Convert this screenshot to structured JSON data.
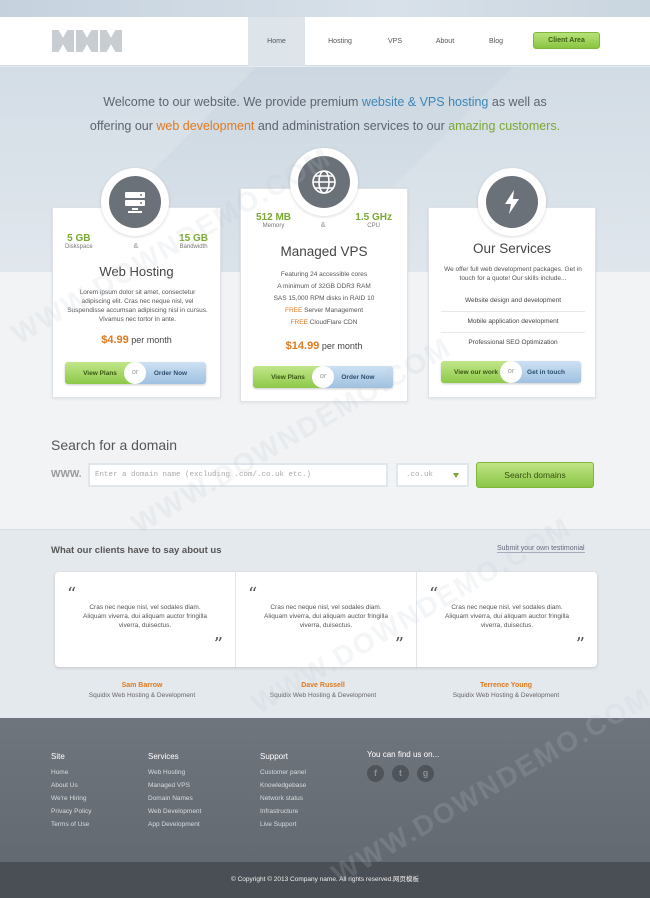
{
  "nav": {
    "items": [
      "Home",
      "Hosting",
      "VPS",
      "About",
      "Blog"
    ],
    "client_area": "Client Area"
  },
  "hero": {
    "line1_a": "Welcome to our website. We provide premium ",
    "line1_b": "website & VPS hosting",
    "line1_c": " as well as",
    "line2_a": "offering our ",
    "line2_b": "web development",
    "line2_c": " and administration services to our ",
    "line2_d": "amazing customers."
  },
  "cards": {
    "web": {
      "spec1_val": "5 GB",
      "spec1_lbl": "Diskspace",
      "amp": "&",
      "spec2_val": "15 GB",
      "spec2_lbl": "Bandwidth",
      "title": "Web Hosting",
      "desc": "Lorem ipsum dolor sit amet, consectetur adipiscing elit. Cras nec neque nisl, vel Suspendisse accumsan adipiscing nisl in cursus. Vivamus nec tortor in ante.",
      "price": "$4.99",
      "per": " per month",
      "btn1": "View Plans",
      "or": "or",
      "btn2": "Order Now"
    },
    "vps": {
      "spec1_val": "512 MB",
      "spec1_lbl": "Memory",
      "amp": "&",
      "spec2_val": "1.5 GHz",
      "spec2_lbl": "CPU",
      "title": "Managed VPS",
      "f1": "Featuring 24 accessible cores",
      "f2": "A minimum of 32GB DDR3 RAM",
      "f3": "SAS 15,000 RPM disks in RAID 10",
      "f4_a": "FREE",
      "f4_b": " Server Management",
      "f5_a": "FREE",
      "f5_b": " CloudFlare CDN",
      "price": "$14.99",
      "per": " per month",
      "btn1": "View Plans",
      "or": "or",
      "btn2": "Order Now"
    },
    "services": {
      "title": "Our Services",
      "desc": "We offer full web development packages. Get in touch for a quote! Our skills include...",
      "items": [
        "Website design and development",
        "Mobile application development",
        "Professional SEO Optimization"
      ],
      "btn1": "View our work",
      "or": "or",
      "btn2": "Get in touch"
    }
  },
  "domain": {
    "title": "Search for a domain",
    "www": "WWW.",
    "placeholder": "Enter a domain name (excluding .com/.co.uk etc.)",
    "tld": ".co.uk",
    "button": "Search domains"
  },
  "testimonials": {
    "title": "What our clients have to say about us",
    "submit": "Submit your own testimonial",
    "open_q": "“",
    "close_q": "”",
    "quotes": [
      "Cras nec neque nisl, vel sodales diam. Aliquam viverra, dui aliquam auctor fringilla viverra, duisectus.",
      "Cras nec neque nisl, vel sodales diam. Aliquam viverra, dui aliquam auctor fringilla viverra, duisectus.",
      "Cras nec neque nisl, vel sodales diam. Aliquam viverra, dui aliquam auctor fringilla viverra, duisectus."
    ],
    "authors": [
      {
        "name": "Sam Barrow",
        "role": "Squidix Web Hosting & Development"
      },
      {
        "name": "Dave Russell",
        "role": "Squidix Web Hosting & Development"
      },
      {
        "name": "Terrence Young",
        "role": "Squidix Web Hosting & Development"
      }
    ]
  },
  "footer": {
    "site": {
      "title": "Site",
      "links": [
        "Home",
        "About Us",
        "We're Hiring",
        "Privacy Policy",
        "Terms of Use"
      ]
    },
    "services": {
      "title": "Services",
      "links": [
        "Web Hosting",
        "Managed VPS",
        "Domain Names",
        "Web Development",
        "App Development"
      ]
    },
    "support": {
      "title": "Support",
      "links": [
        "Customer panel",
        "Knowledgebase",
        "Network status",
        "Infrastructure",
        "Live Support"
      ]
    },
    "find": {
      "title": "You can find us on...",
      "icons": [
        "f",
        "t",
        "g"
      ]
    },
    "copyright": "© Copyright © 2013 Company name. All rights reserved.网页模板"
  },
  "watermark": "WWW.DOWNDEMO.COM",
  "colors": {
    "accent_blue": "#3c86b8",
    "accent_orange": "#e07a1f",
    "accent_green": "#7aa832"
  }
}
